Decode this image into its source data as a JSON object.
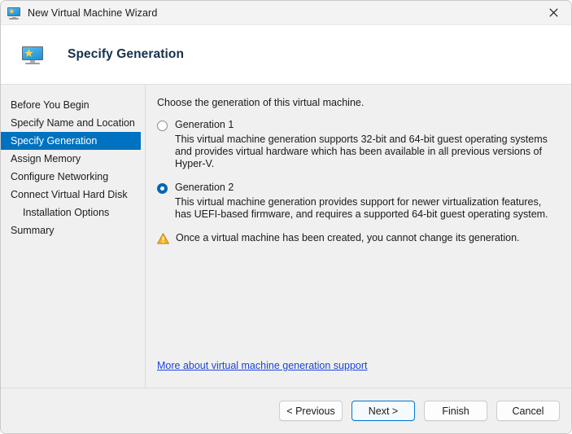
{
  "window": {
    "title": "New Virtual Machine Wizard",
    "titlebar_icon": "virtual-machine-monitor-icon",
    "close_label": "✕"
  },
  "header": {
    "title": "Specify Generation",
    "icon": "virtual-machine-monitor-icon"
  },
  "sidebar": {
    "items": [
      {
        "label": "Before You Begin",
        "selected": false,
        "indent": false
      },
      {
        "label": "Specify Name and Location",
        "selected": false,
        "indent": false
      },
      {
        "label": "Specify Generation",
        "selected": true,
        "indent": false
      },
      {
        "label": "Assign Memory",
        "selected": false,
        "indent": false
      },
      {
        "label": "Configure Networking",
        "selected": false,
        "indent": false
      },
      {
        "label": "Connect Virtual Hard Disk",
        "selected": false,
        "indent": false
      },
      {
        "label": "Installation Options",
        "selected": false,
        "indent": true
      },
      {
        "label": "Summary",
        "selected": false,
        "indent": false
      }
    ]
  },
  "main": {
    "intro": "Choose the generation of this virtual machine.",
    "options": [
      {
        "label": "Generation 1",
        "selected": false,
        "description": "This virtual machine generation supports 32-bit and 64-bit guest operating systems and provides virtual hardware which has been available in all previous versions of Hyper-V."
      },
      {
        "label": "Generation 2",
        "selected": true,
        "description": "This virtual machine generation provides support for newer virtualization features, has UEFI-based firmware, and requires a supported 64-bit guest operating system."
      }
    ],
    "warning": {
      "icon": "warning-triangle-icon",
      "text": "Once a virtual machine has been created, you cannot change its generation."
    },
    "link": {
      "text": "More about virtual machine generation support"
    }
  },
  "footer": {
    "buttons": [
      {
        "label": "< Previous",
        "default": false
      },
      {
        "label": "Next >",
        "default": true
      },
      {
        "label": "Finish",
        "default": false
      },
      {
        "label": "Cancel",
        "default": false
      }
    ]
  },
  "colors": {
    "accent": "#0072bf",
    "radio_selected": "#0067b8",
    "link": "#1b45d8",
    "warning": "#f0a30a",
    "body_bg": "#f0f0f0",
    "header_bg": "#ffffff",
    "titlebar_bg": "#f3f3f3",
    "title_text": "#15314b"
  }
}
